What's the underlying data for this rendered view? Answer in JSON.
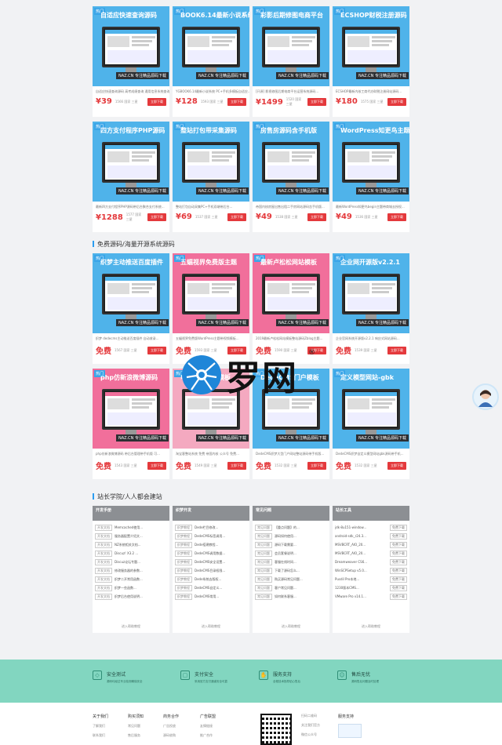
{
  "paid_products_row1": [
    {
      "banner": "自适应快速查询源码",
      "desc": "自适应快速查询源码 高考成绩查询 通用信息系统查询...",
      "price": "¥39",
      "meta": "1566 国家 三星",
      "buy": "立即下载",
      "color": "#4fb3ea"
    },
    {
      "banner": "BOOK6.14最新小说系统",
      "desc": "YGBOOK6.14最新小说系统 PC+手机多模板自适应...",
      "price": "¥128",
      "meta": "1593 国家 三星",
      "buy": "立即下载",
      "color": "#4fb3ea"
    },
    {
      "banner": "彩影后期修图电商平台",
      "desc": "[开源] 影视修图后期电商平台运营系统源码...",
      "price": "¥1499",
      "meta": "1520 国家 三星",
      "buy": "立即下载",
      "color": "#4fb3ea"
    },
    {
      "banner": "ECSHOP财税注册源码",
      "desc": "ECSHOP最新内核工商代办财税注册网站源码...",
      "price": "¥180",
      "meta": "1575 国家 三星",
      "buy": "立即下载",
      "color": "#4fb3ea"
    }
  ],
  "paid_products_row2": [
    {
      "banner": "四方支付程序PHP源码",
      "desc": "最新四方支付程序PHP源码带后台聚合支付系统...",
      "price": "¥1288",
      "meta": "1577 国家 三星",
      "buy": "立即下载",
      "color": "#4fb3ea"
    },
    {
      "banner": "整站打包带采集源码",
      "desc": "整站打包自动采集PC+手机双端带后台...",
      "price": "¥69",
      "meta": "1537 国家 三星",
      "buy": "立即下载",
      "color": "#4fb3ea"
    },
    {
      "banner": "房售房源码含手机版",
      "desc": "帝国内核房屋出售出租二手房网站源码含手机版...",
      "price": "¥49",
      "meta": "1538 国家 三星",
      "buy": "立即下载",
      "color": "#4fb3ea"
    },
    {
      "banner": "WordPress知更鸟主题",
      "desc": "最新WordPress知更鸟begin主题带商城去授权...",
      "price": "¥49",
      "meta": "1536 国家 三星",
      "buy": "立即下载",
      "color": "#4fb3ea"
    }
  ],
  "free_section_title": "免费源码/海量开源系统源码",
  "free_products_row1": [
    {
      "banner": "织梦主动推送百度插件",
      "desc": "织梦 dedecms主动推送百度插件 自动收录...",
      "price": "免费",
      "meta": "1567 国家 三星",
      "buy": "立即下载",
      "color": "#4fb3ea"
    },
    {
      "banner": "五蝠视界免费版主题",
      "desc": "五蝠视界免费版WordPress主题带视频模板...",
      "price": "免费",
      "meta": "1593 国家 三星",
      "buy": "立即下载",
      "color": "#f16f9b"
    },
    {
      "banner": "最新卢松松网站模板",
      "desc": "2019最新卢松松网站模板整站源码Zblog主题...",
      "price": "免费",
      "meta": "1590 国家 三星",
      "buy": "立即下载",
      "color": "#f16f9b"
    },
    {
      "banner": "企业网开源版v2.2.1",
      "desc": "企业官网系统开源版v2.2.1 响应式网站源码...",
      "price": "免费",
      "meta": "1539 国家 三星",
      "buy": "立即下载",
      "color": "#4fb3ea"
    }
  ],
  "free_products_row2": [
    {
      "banner": "php仿新浪微博源码",
      "desc": "php仿新浪微博源码 带后台管理带手机版 可...",
      "price": "免费",
      "meta": "1543 国家 三星",
      "buy": "立即下载",
      "color": "#f16f9b"
    },
    {
      "banner": "电影网站源码模板",
      "desc": "淘宝客整站系统 免费 帝国内核 公众号 免费...",
      "price": "免费",
      "meta": "1549 国家 三星",
      "buy": "立即下载",
      "color": "#f4a9c0"
    },
    {
      "banner": "DedeCMS门户模板",
      "desc": "DedeCMS织梦大型门户网站整站源码带手机版...",
      "price": "免费",
      "meta": "1532 国家 三星",
      "buy": "立即下载",
      "color": "#4fb3ea"
    },
    {
      "banner": "定义模型网站-gbk",
      "desc": "DedeCMS织梦自定义模型网站gbk源码带手机...",
      "price": "免费",
      "meta": "1532 国家 三星",
      "buy": "立即下载",
      "color": "#4fb3ea"
    }
  ],
  "academy_title": "站长学院/人人都会建站",
  "article_cols": [
    {
      "title": "开发手册",
      "items": [
        [
          "开发文档",
          "Memcached使用..."
        ],
        [
          "开发文档",
          "服务器配置介绍文..."
        ],
        [
          "开发文档",
          "NZ系统相关文档..."
        ],
        [
          "开发文档",
          "Discuz! X3.2 ..."
        ],
        [
          "开发文档",
          "Discuz论坛专题..."
        ],
        [
          "开发文档",
          "修改服务器的参数..."
        ],
        [
          "开发文档",
          "织梦二开常用函数..."
        ],
        [
          "开发文档",
          "织梦一些函数..."
        ],
        [
          "开发文档",
          "织梦后台使用说明..."
        ]
      ],
      "more": "进入帮助教程"
    },
    {
      "title": "织梦开发",
      "items": [
        [
          "织梦教程",
          "Dede栏目修改..."
        ],
        [
          "织梦教程",
          "DedeCMS标签调用..."
        ],
        [
          "织梦教程",
          "Dede搭建教程..."
        ],
        [
          "织梦教程",
          "DedeCMS调用数据..."
        ],
        [
          "织梦教程",
          "DedeCMS安全设置..."
        ],
        [
          "织梦教程",
          "DedeCMS目录权限..."
        ],
        [
          "织梦教程",
          "Dede系统去版权..."
        ],
        [
          "织梦教程",
          "DedeCMS自定义..."
        ],
        [
          "织梦教程",
          "DedeCMS常用..."
        ]
      ],
      "more": "进入帮助教程"
    },
    {
      "title": "常见问题",
      "items": [
        [
          "常见问题",
          "【重点问题】的..."
        ],
        [
          "常见问题",
          "源码如何使用..."
        ],
        [
          "常见问题",
          "源码下载需要..."
        ],
        [
          "常见问题",
          "会员套餐说明..."
        ],
        [
          "常见问题",
          "客服在线时间..."
        ],
        [
          "常见问题",
          "下载了源码怎么..."
        ],
        [
          "常见问题",
          "购买源码常见问题..."
        ],
        [
          "常见问题",
          "客户常见问题..."
        ],
        [
          "常见问题",
          "如何联系客服..."
        ]
      ],
      "more": "进入帮助教程"
    },
    {
      "title": "站长工具",
      "items": [
        [
          "jdk-8u151-window...",
          "免费下载"
        ],
        [
          "android-sdk_r24.3...",
          "免费下载"
        ],
        [
          "MSVBCRT_AIO_20...",
          "免费下载"
        ],
        [
          "MSVBCRT_AIO_20...",
          "免费下载"
        ],
        [
          "Dreamweaver CS6...",
          "免费下载"
        ],
        [
          "WinSCPSetup v5.0...",
          "免费下载"
        ],
        [
          "Pusdil Pro本地...",
          "免费下载"
        ],
        [
          "1230版本CMS...",
          "免费下载"
        ],
        [
          "VMware Pro v14.1...",
          "免费下载"
        ]
      ],
      "more": "进入帮助教程"
    }
  ],
  "features": [
    {
      "icon": "shield-icon",
      "title": "安全测试",
      "sub": "源码均经过专业检测确保安全"
    },
    {
      "icon": "lock-icon",
      "title": "支付安全",
      "sub": "采用官方支付通道安全可靠"
    },
    {
      "icon": "hand-icon",
      "title": "服务支持",
      "sub": "全程技术指导贴心售后"
    },
    {
      "icon": "service-icon",
      "title": "售后无忧",
      "sub": "源码售后问题及时处理"
    }
  ],
  "footer_cols": [
    {
      "title": "关于我们",
      "links": [
        "了解我们",
        "联系我们"
      ]
    },
    {
      "title": "购买须知",
      "links": [
        "常见问题",
        "售后服务"
      ]
    },
    {
      "title": "商务合作",
      "links": [
        "广告投放",
        "源码收购"
      ]
    },
    {
      "title": "广告联盟",
      "links": [
        "友情链接",
        "推广合作"
      ]
    }
  ],
  "footer_qr_caption": [
    "扫码二维码",
    "关注我们官方",
    "微信公众号"
  ],
  "footer_service_title": "服务支持",
  "logo": {
    "text": "罗网",
    "reg": "®"
  },
  "colors": {
    "accent": "#2b9df0",
    "price": "#e4393c",
    "feature_bg": "#82d6c0"
  }
}
